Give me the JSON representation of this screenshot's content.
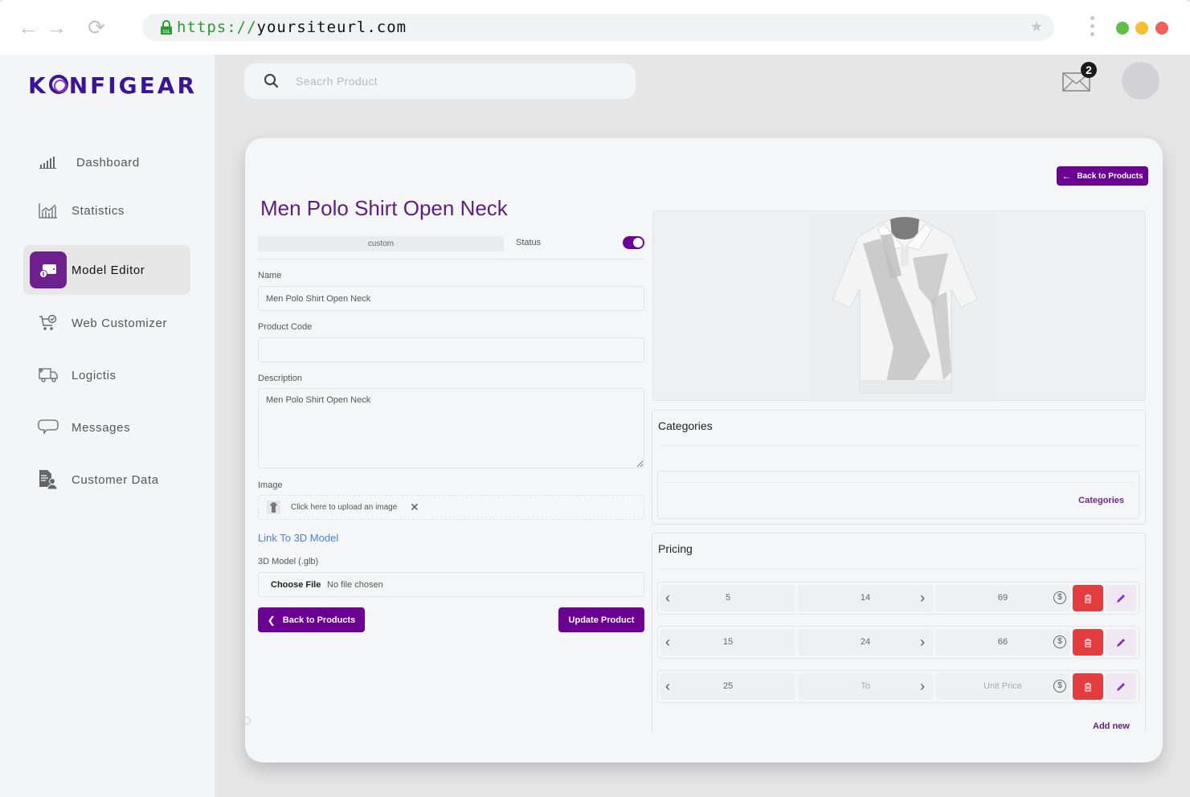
{
  "browser": {
    "url_protocol": "https://",
    "url_host": "yoursiteurl.com",
    "window_dots": [
      "#5fbf48",
      "#fbbd30",
      "#f0605a"
    ]
  },
  "brand": {
    "logo_prefix": "K",
    "logo_suffix": "NFIGEAR",
    "accent": "#6c0092"
  },
  "sidebar": {
    "items": [
      {
        "label": "Dashboard",
        "icon": "signal-bars-icon",
        "active": false
      },
      {
        "label": "Statistics",
        "icon": "chart-icon",
        "active": false
      },
      {
        "label": "Model Editor",
        "icon": "wallet-icon",
        "active": true
      },
      {
        "label": "Web Customizer",
        "icon": "cart-check-icon",
        "active": false
      },
      {
        "label": "Logictis",
        "icon": "truck-icon",
        "active": false
      },
      {
        "label": "Messages",
        "icon": "chat-bubble-icon",
        "active": false
      },
      {
        "label": "Customer Data",
        "icon": "customer-file-icon",
        "active": false
      }
    ]
  },
  "topbar": {
    "search_placeholder": "Seacrh Product",
    "mail_count": "2"
  },
  "editor": {
    "back_top_label": "Back to Products",
    "title": "Men Polo Shirt Open Neck",
    "type_pill": "custom",
    "status_label": "Status",
    "status_on": true,
    "name_label": "Name",
    "name_value": "Men Polo Shirt Open Neck",
    "code_label": "Product Code",
    "code_value": "",
    "description_label": "Description",
    "description_value": "Men Polo Shirt Open Neck",
    "image_label": "Image",
    "upload_text": "Click here to upload an image",
    "upload_clear": "✕",
    "link_3d": "Link To 3D Model",
    "model_label": "3D Model (.glb)",
    "choose_file": "Choose File",
    "no_file": "No file chosen",
    "back_bottom_label": "Back to Products",
    "update_label": "Update Product"
  },
  "categories": {
    "title": "Categories",
    "link": "Categories"
  },
  "pricing": {
    "title": "Pricing",
    "rows": [
      {
        "from": "5",
        "to": "14",
        "price": "69",
        "to_placeholder": false,
        "price_placeholder": false
      },
      {
        "from": "15",
        "to": "24",
        "price": "66",
        "to_placeholder": false,
        "price_placeholder": false
      },
      {
        "from": "25",
        "to": "To",
        "price": "Unit Price",
        "to_placeholder": true,
        "price_placeholder": true
      }
    ],
    "currency_symbol": "$",
    "add_new": "Add new"
  }
}
